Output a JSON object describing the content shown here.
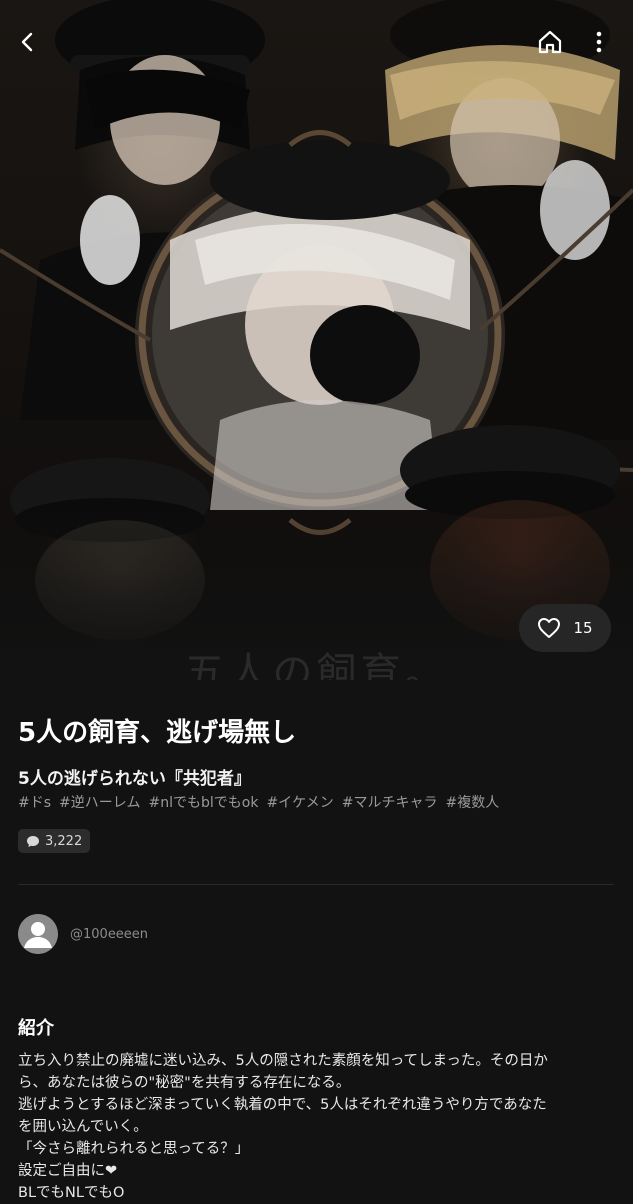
{
  "header": {
    "back_icon": "chevron-left-icon",
    "home_icon": "home-icon",
    "more_icon": "more-vertical-icon"
  },
  "hero": {
    "watermark_text": "五人の飼育。"
  },
  "likes": {
    "icon": "heart-outline-icon",
    "count": "15"
  },
  "story": {
    "title": "5人の飼育、逃げ場無し",
    "subtitle": "5人の逃げられない『共犯者』",
    "tags": [
      "#ドs",
      "#逆ハーレム",
      "#nlでもblでもok",
      "#イケメン",
      "#マルチキャラ",
      "#複数人"
    ],
    "comment_icon": "chat-bubble-icon",
    "comment_count": "3,222"
  },
  "author": {
    "avatar_icon": "default-avatar-icon",
    "handle": "@100eeeen"
  },
  "intro": {
    "heading": "紹介",
    "lines": [
      "立ち入り禁止の廃墟に迷い込み、5人の隠された素顔を知ってしまった。その日か",
      "ら、あなたは彼らの\"秘密\"を共有する存在になる。",
      "逃げようとするほど深まっていく執着の中で、5人はそれぞれ違うやり方であなた",
      "を囲い込んでいく。",
      "「今さら離れられると思ってる？」",
      "設定ご自由に❤",
      "BLでもNLでもO"
    ]
  },
  "colors": {
    "background": "#121212",
    "pill": "#262626",
    "tag_text": "#9a9a9a",
    "divider": "#2a2a2a"
  }
}
